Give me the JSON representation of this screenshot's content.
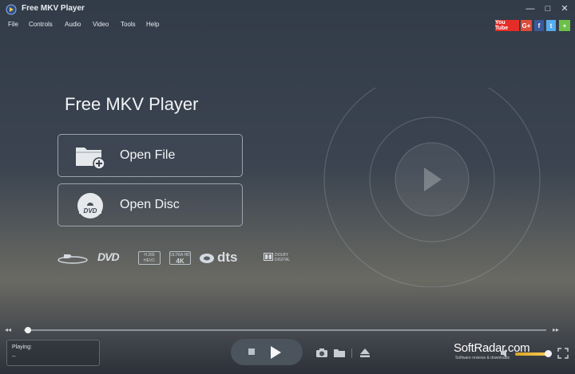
{
  "window": {
    "title": "Free MKV Player",
    "controls": [
      "—",
      "□",
      "✕"
    ]
  },
  "menu": [
    "File",
    "Controls",
    "Audio",
    "Video",
    "Tools",
    "Help"
  ],
  "social": {
    "youtube": "You Tube",
    "googleplus": "G+",
    "facebook": "f",
    "twitter": "t",
    "share": "+"
  },
  "main": {
    "title": "Free MKV Player",
    "open_file": "Open File",
    "open_disc": "Open Disc",
    "disc_badge": "DVD",
    "formats": {
      "bluray": "Blu-ray",
      "dvd": "DVD",
      "h265_top": "H.265",
      "h265_bottom": "HEVC",
      "uhd_top": "ULTRA HD",
      "uhd_bottom": "4K",
      "dts": "dts",
      "dolby_top": "DOLBY",
      "dolby_bottom": "DIGITAL"
    }
  },
  "player": {
    "playing_label": "Playing:",
    "playing_value": "--",
    "progress": 0.0
  },
  "watermark": {
    "brand": "SoftRadar.com",
    "tagline": "Software reviews & downloads"
  },
  "colors": {
    "accent": "#f5c650",
    "youtube": "#e52d27",
    "googleplus": "#dd4b39",
    "facebook": "#3b5998",
    "twitter": "#55acee",
    "share": "#6cc04a"
  }
}
